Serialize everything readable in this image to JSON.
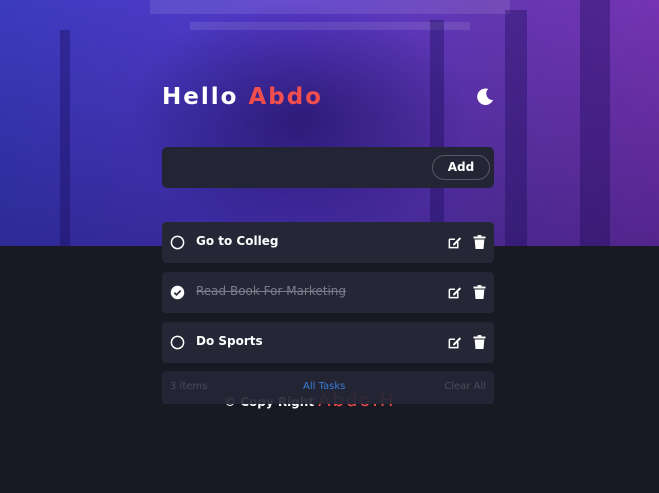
{
  "header": {
    "greeting": "Hello",
    "name": "Abdo",
    "theme_icon": "moon-icon"
  },
  "new_task": {
    "value": "",
    "placeholder": "",
    "add_label": "Add"
  },
  "tasks": [
    {
      "text": "Go to Colleg",
      "completed": false
    },
    {
      "text": "Read Book For Marketing",
      "completed": true
    },
    {
      "text": "Do Sports",
      "completed": false
    }
  ],
  "footer": {
    "items_left": "3 items",
    "filter": "All Tasks",
    "clear": "Clear All"
  },
  "copyright": {
    "label": "Copy Right",
    "owner": "Abdo.H"
  },
  "colors": {
    "accent_red": "#f24e4e",
    "active_filter_blue": "#3a7bd5",
    "card_bg": "#252736",
    "page_bg": "#181922"
  }
}
